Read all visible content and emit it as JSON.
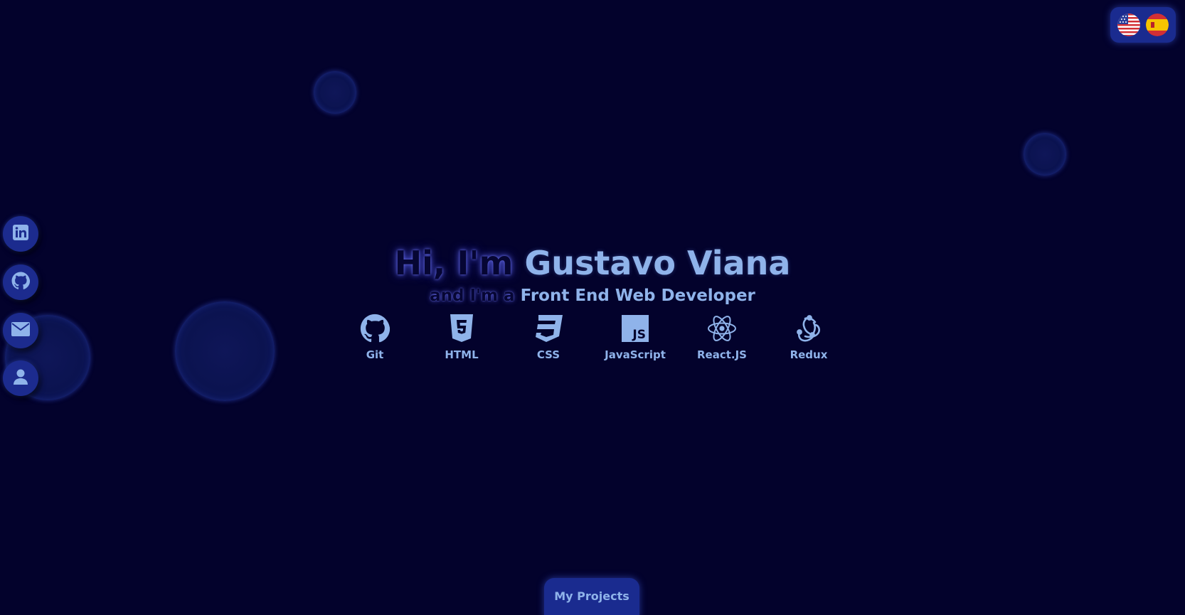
{
  "hero": {
    "greeting": "Hi, I'm",
    "name": "Gustavo Viana",
    "subtitle_prefix": "and I'm a",
    "role": "Front End Web Developer"
  },
  "skills": [
    {
      "label": "Git",
      "icon": "github-icon"
    },
    {
      "label": "HTML",
      "icon": "html5-icon"
    },
    {
      "label": "CSS",
      "icon": "css3-icon"
    },
    {
      "label": "JavaScript",
      "icon": "javascript-icon"
    },
    {
      "label": "React.JS",
      "icon": "react-icon"
    },
    {
      "label": "Redux",
      "icon": "redux-icon"
    }
  ],
  "social": [
    {
      "icon": "linkedin-icon"
    },
    {
      "icon": "github-icon"
    },
    {
      "icon": "mail-icon"
    },
    {
      "icon": "user-icon"
    }
  ],
  "language": {
    "options": [
      {
        "icon": "us-flag-icon"
      },
      {
        "icon": "spain-flag-icon"
      }
    ]
  },
  "projects_button": {
    "label": "My Projects"
  },
  "colors": {
    "background": "#03022c",
    "accent": "#8fb3ea",
    "button": "#1a2b8f"
  }
}
